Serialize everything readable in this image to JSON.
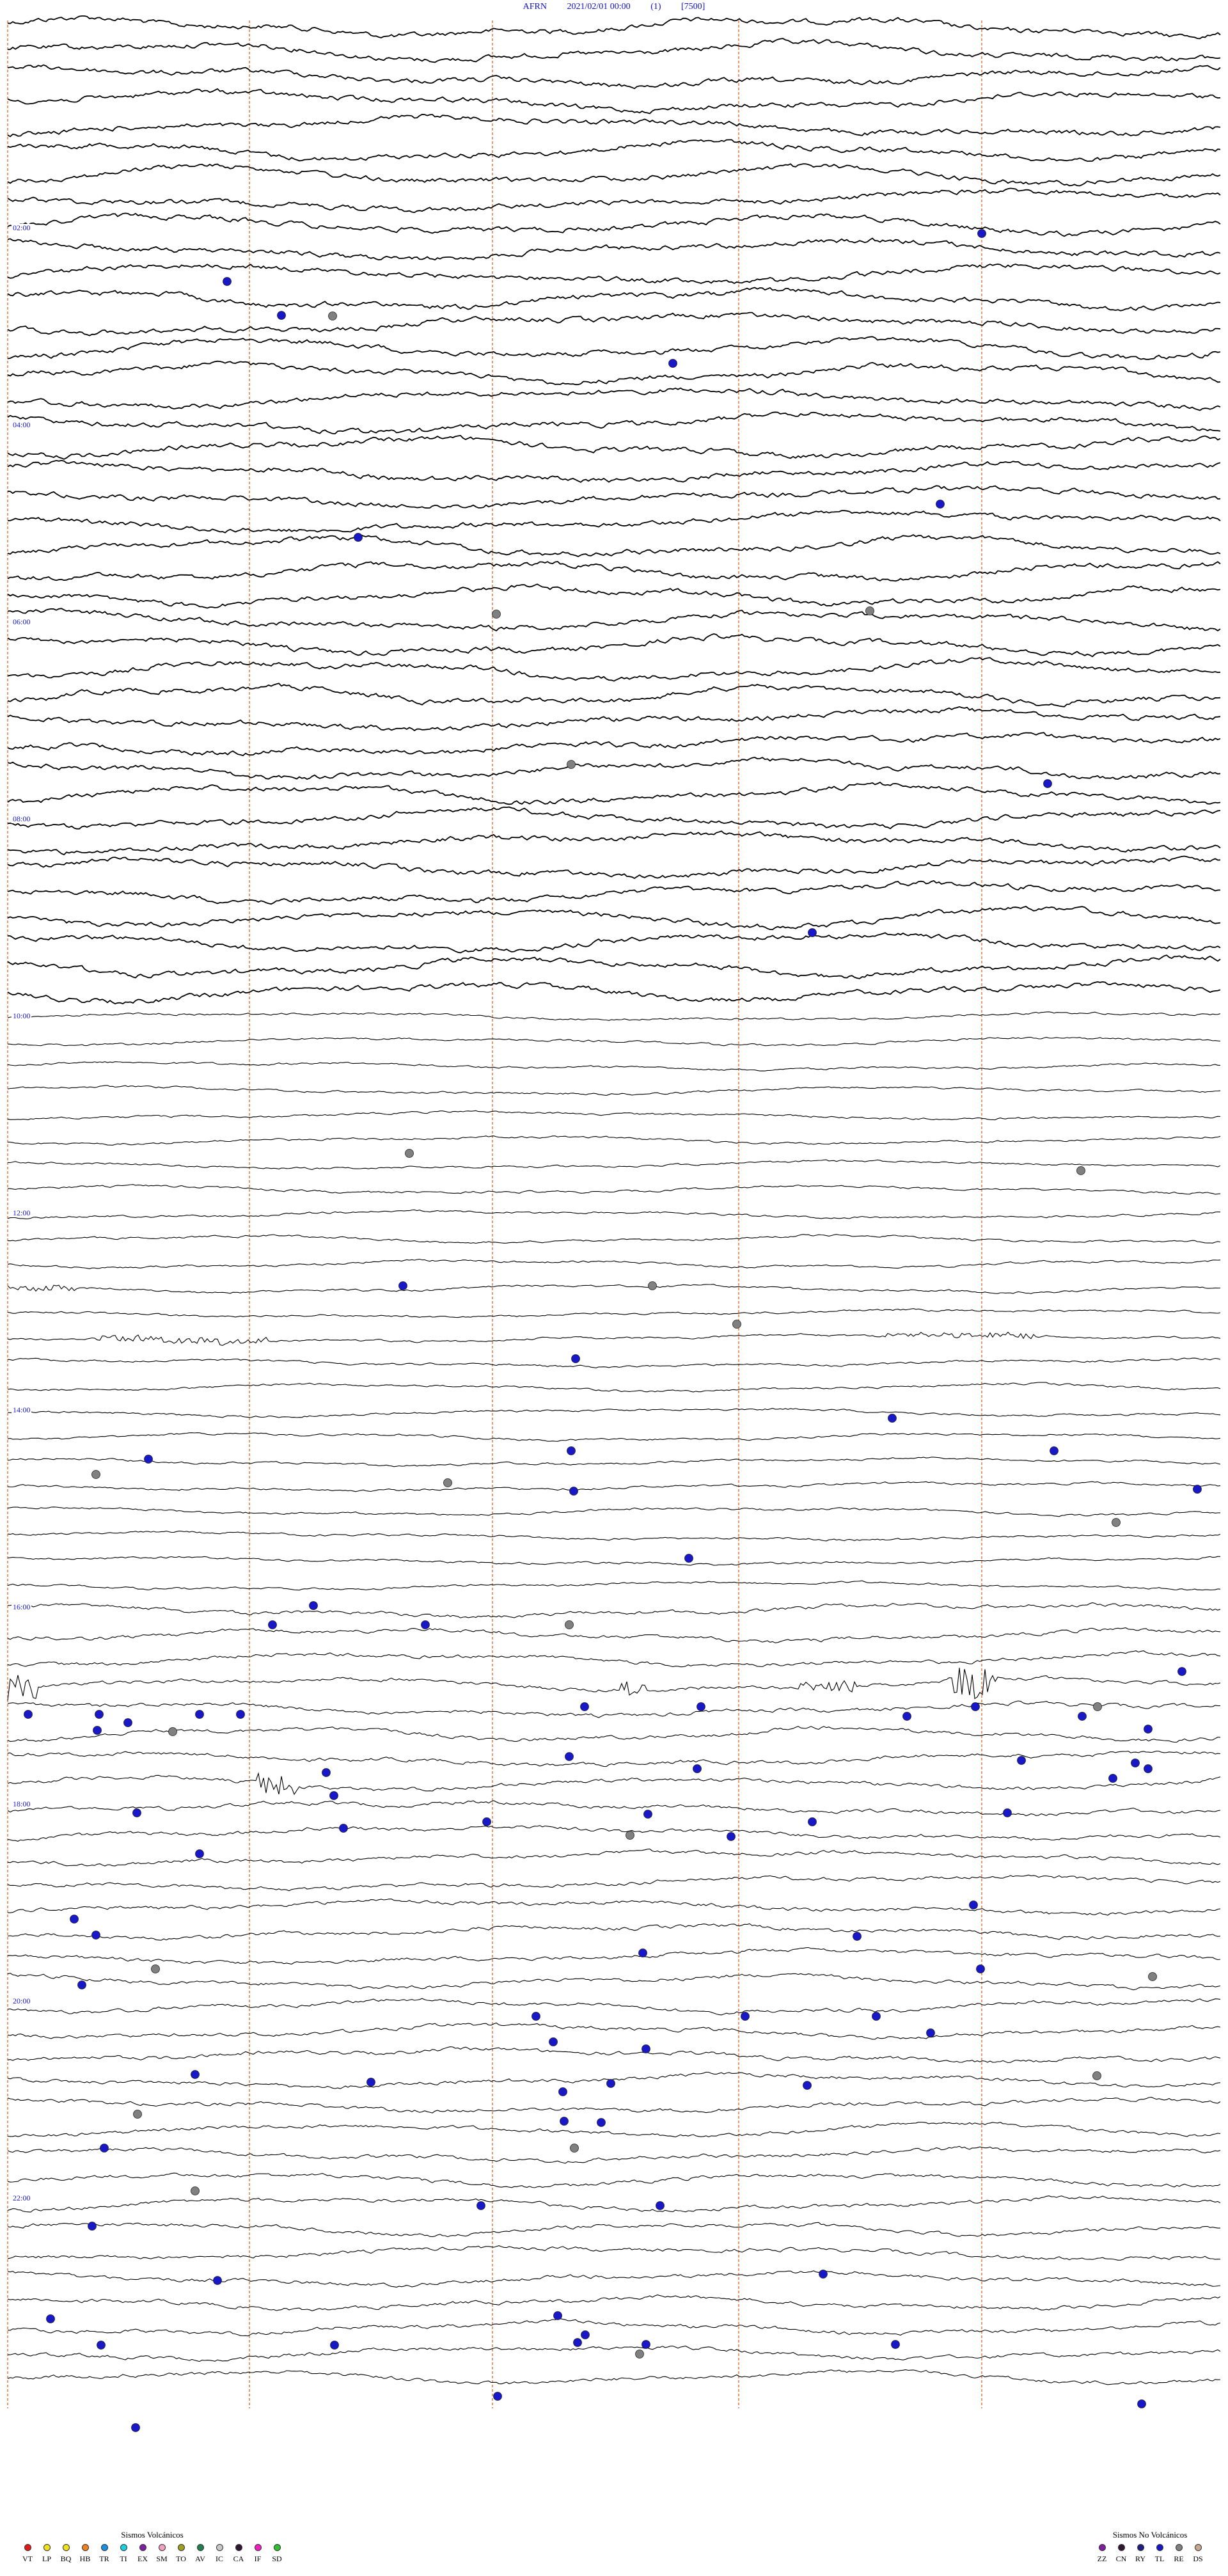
{
  "header": {
    "station": "AFRN",
    "datetime": "2021/02/01 00:00",
    "channel": "(1)",
    "scale": "[7500]"
  },
  "hour_labels": [
    "02:00",
    "04:00",
    "06:00",
    "08:00",
    "10:00",
    "12:00",
    "14:00",
    "16:00",
    "18:00",
    "20:00",
    "22:00"
  ],
  "legend_volcanic": {
    "title": "Sismos Volcánicos",
    "items": [
      {
        "code": "VT",
        "color": "#e01818"
      },
      {
        "code": "LP",
        "color": "#f0e020"
      },
      {
        "code": "BQ",
        "color": "#f0e020"
      },
      {
        "code": "HB",
        "color": "#f08020"
      },
      {
        "code": "TR",
        "color": "#1890e0"
      },
      {
        "code": "TI",
        "color": "#18d0e0"
      },
      {
        "code": "EX",
        "color": "#8020a0"
      },
      {
        "code": "SM",
        "color": "#f0a0c0"
      },
      {
        "code": "TO",
        "color": "#a0a020"
      },
      {
        "code": "AV",
        "color": "#208050"
      },
      {
        "code": "IC",
        "color": "#c8c8c8"
      },
      {
        "code": "CA",
        "color": "#301830"
      },
      {
        "code": "IF",
        "color": "#f020c0"
      },
      {
        "code": "SD",
        "color": "#30c030"
      }
    ]
  },
  "legend_nonvolcanic": {
    "title": "Sismos No Volcánicos",
    "items": [
      {
        "code": "ZZ",
        "color": "#8020a0"
      },
      {
        "code": "CN",
        "color": "#301830"
      },
      {
        "code": "RY",
        "color": "#202080"
      },
      {
        "code": "TL",
        "color": "#1818c8"
      },
      {
        "code": "RE",
        "color": "#808080"
      },
      {
        "code": "DS",
        "color": "#c8a890"
      }
    ]
  },
  "colors": {
    "trace": "#000000",
    "event_teleseism": "#1818c8",
    "event_regional": "#808080",
    "minute_marker": "#e07030",
    "header_text": "#1010c8"
  }
}
